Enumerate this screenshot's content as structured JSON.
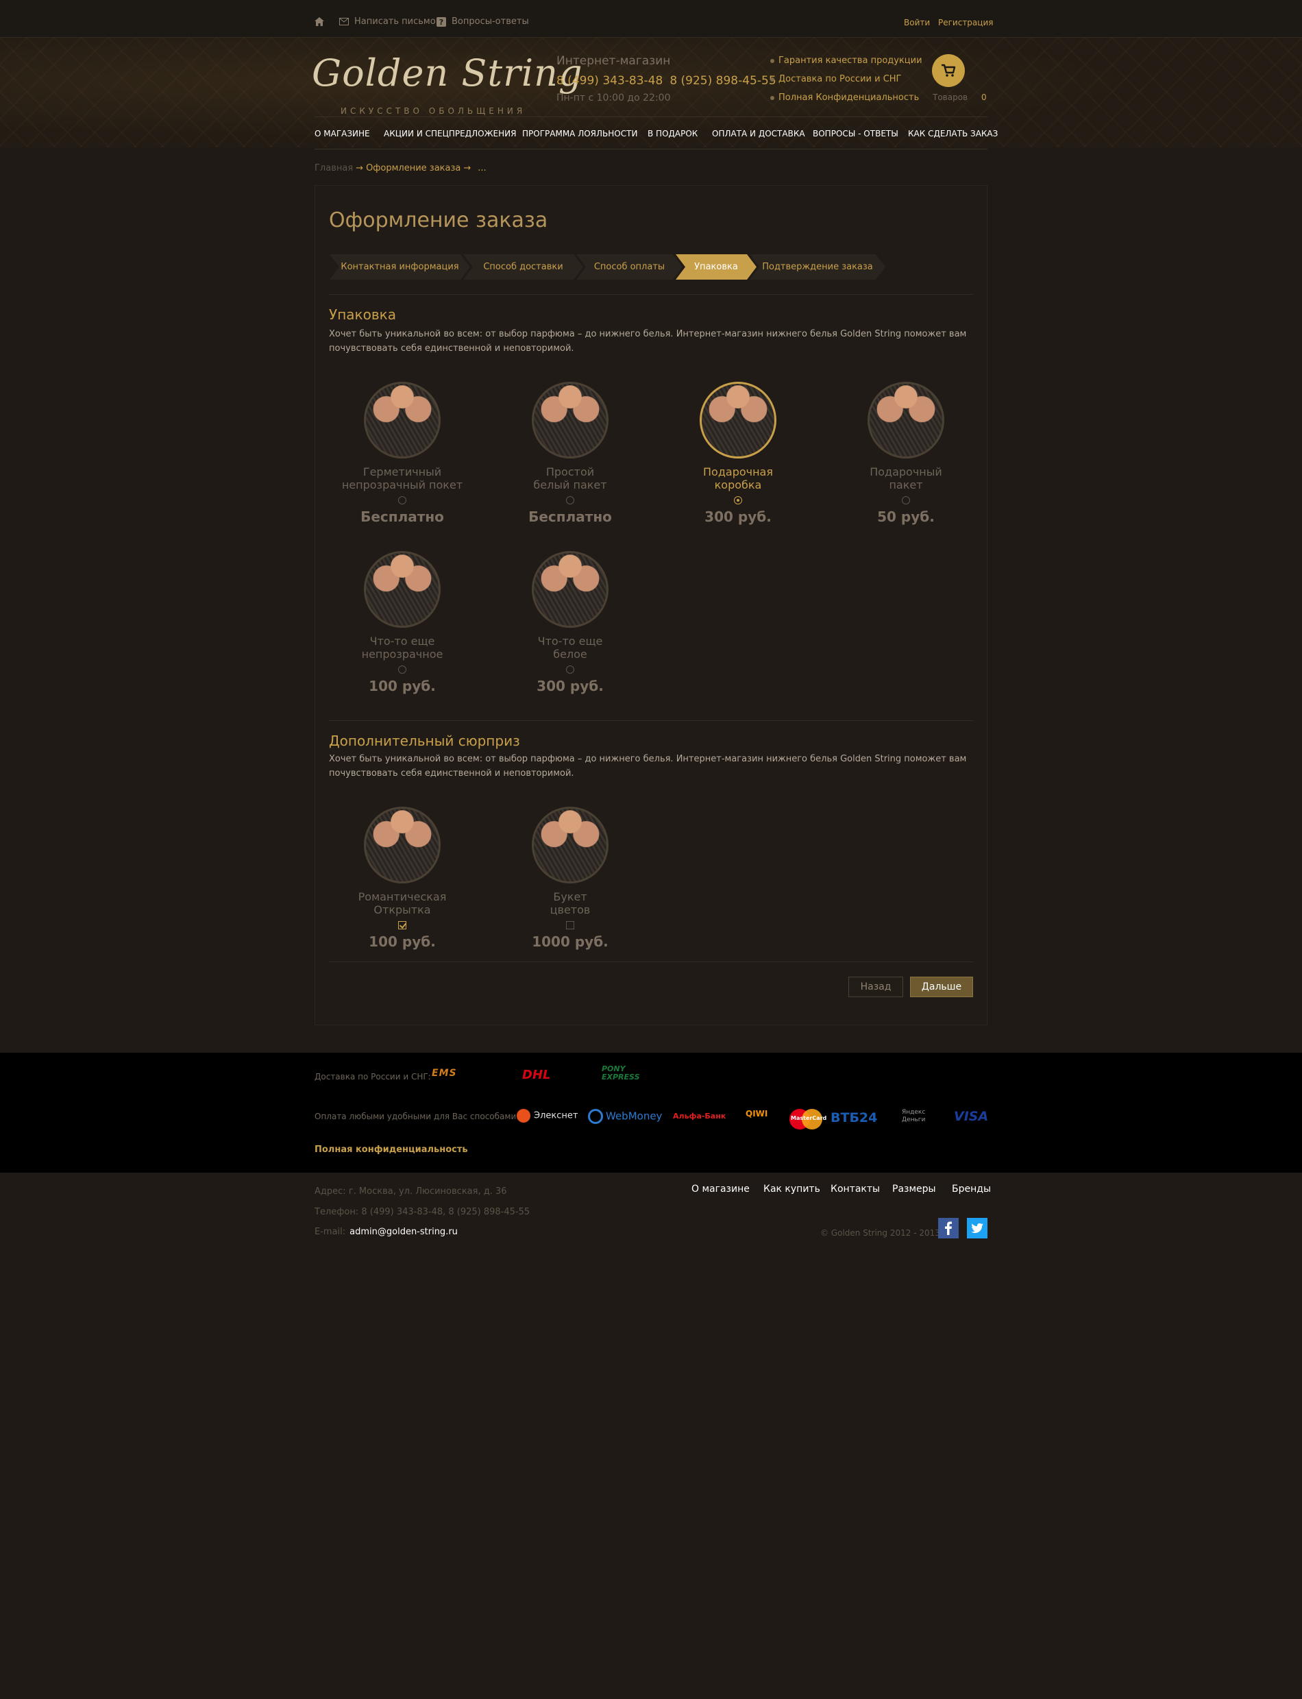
{
  "topbar": {
    "write_label": "Написать письмо",
    "faq_label": "Вопросы-ответы",
    "login_label": "Войти",
    "register_label": "Регистрация"
  },
  "header": {
    "logo_text": "Golden String",
    "logo_tagline": "ИСКУССТВО ОБОЛЬЩЕНИЯ",
    "shop_title": "Интернет-магазин",
    "phone_1": "8 (499) 343-83-48",
    "phone_2": "8 (925) 898-45-55",
    "hours": "Пн-пт с 10:00 до 22:00",
    "features": [
      "Гарантия качества продукции",
      "Доставка по России и СНГ",
      "Полная Конфиденциальность"
    ],
    "cart_label": "Товаров",
    "cart_count": "0"
  },
  "nav": {
    "items": [
      "О МАГАЗИНЕ",
      "АКЦИИ И СПЕЦПРЕДЛОЖЕНИЯ",
      "ПРОГРАММА ЛОЯЛЬНОСТИ",
      "В ПОДАРОК",
      "ОПЛАТА И ДОСТАВКА",
      "ВОПРОСЫ - ОТВЕТЫ",
      "КАК СДЕЛАТЬ ЗАКАЗ"
    ]
  },
  "breadcrumb": {
    "home": "Главная",
    "current": "Оформление заказа",
    "dots": "..."
  },
  "checkout": {
    "title": "Оформление заказа",
    "steps": [
      "Контактная информация",
      "Способ доставки",
      "Способ оплаты",
      "Упаковка",
      "Подтверждение заказа"
    ],
    "active_step": "Упаковка"
  },
  "packaging": {
    "title": "Упаковка",
    "description": "Хочет быть уникальной во всем: от выбор парфюма – до нижнего белья. Интернет-магазин нижнего белья Golden String поможет вам почувствовать себя единственной и неповторимой.",
    "options": [
      {
        "line1": "Герметичный",
        "line2": "непрозрачный покет",
        "price": "Бесплатно",
        "selected": false
      },
      {
        "line1": "Простой",
        "line2": "белый пакет",
        "price": "Бесплатно",
        "selected": false
      },
      {
        "line1": "Подарочная",
        "line2": "коробка",
        "price": "300 руб.",
        "selected": true
      },
      {
        "line1": "Подарочный",
        "line2": "пакет",
        "price": "50 руб.",
        "selected": false
      },
      {
        "line1": "Что-то еще",
        "line2": "непрозрачное",
        "price": "100 руб.",
        "selected": false
      },
      {
        "line1": "Что-то еще",
        "line2": "белое",
        "price": "300 руб.",
        "selected": false
      }
    ]
  },
  "surprise": {
    "title": "Дополнительный сюрприз",
    "description": "Хочет быть уникальной во всем: от выбор парфюма – до нижнего белья. Интернет-магазин нижнего белья Golden String поможет вам почувствовать себя единственной и неповторимой.",
    "options": [
      {
        "line1": "Романтическая",
        "line2": "Открытка",
        "price": "100 руб.",
        "checked": true
      },
      {
        "line1": "Букет",
        "line2": "цветов",
        "price": "1000 руб.",
        "checked": false
      }
    ]
  },
  "buttons": {
    "back": "Назад",
    "next": "Дальше"
  },
  "footer": {
    "delivery_label": "Доставка по России и СНГ:",
    "delivery_logos": [
      "EMS",
      "DHL",
      "PONY EXPRESS"
    ],
    "payment_label": "Оплата любыми удобными для Вас способами:",
    "payment_logos": [
      "Элекснет",
      "WebMoney",
      "Альфа-Банк",
      "QIWI",
      "MasterCard",
      "ВТБ24",
      "Яндекс Деньги",
      "VISA"
    ],
    "confidentiality": "Полная конфиденциальность",
    "address_label": "Адрес:",
    "address_value": "г. Москва, ул. Люсиновская, д. 36",
    "phone_label": "Телефон:",
    "phone_value": "8 (499) 343-83-48, 8 (925) 898-45-55",
    "email_label": "E-mail:",
    "email_value": "admin@golden-string.ru",
    "links": [
      "О магазине",
      "Как купить",
      "Контакты",
      "Размеры",
      "Бренды"
    ],
    "copyright": "© Golden String 2012 - 2013"
  },
  "colors": {
    "accent": "#c9a04a",
    "background": "#1f1a16",
    "panel": "#201b17",
    "footer": "#000000"
  },
  "icons": [
    "home-icon",
    "mail-icon",
    "question-icon",
    "cart-icon",
    "facebook-icon",
    "twitter-icon"
  ]
}
